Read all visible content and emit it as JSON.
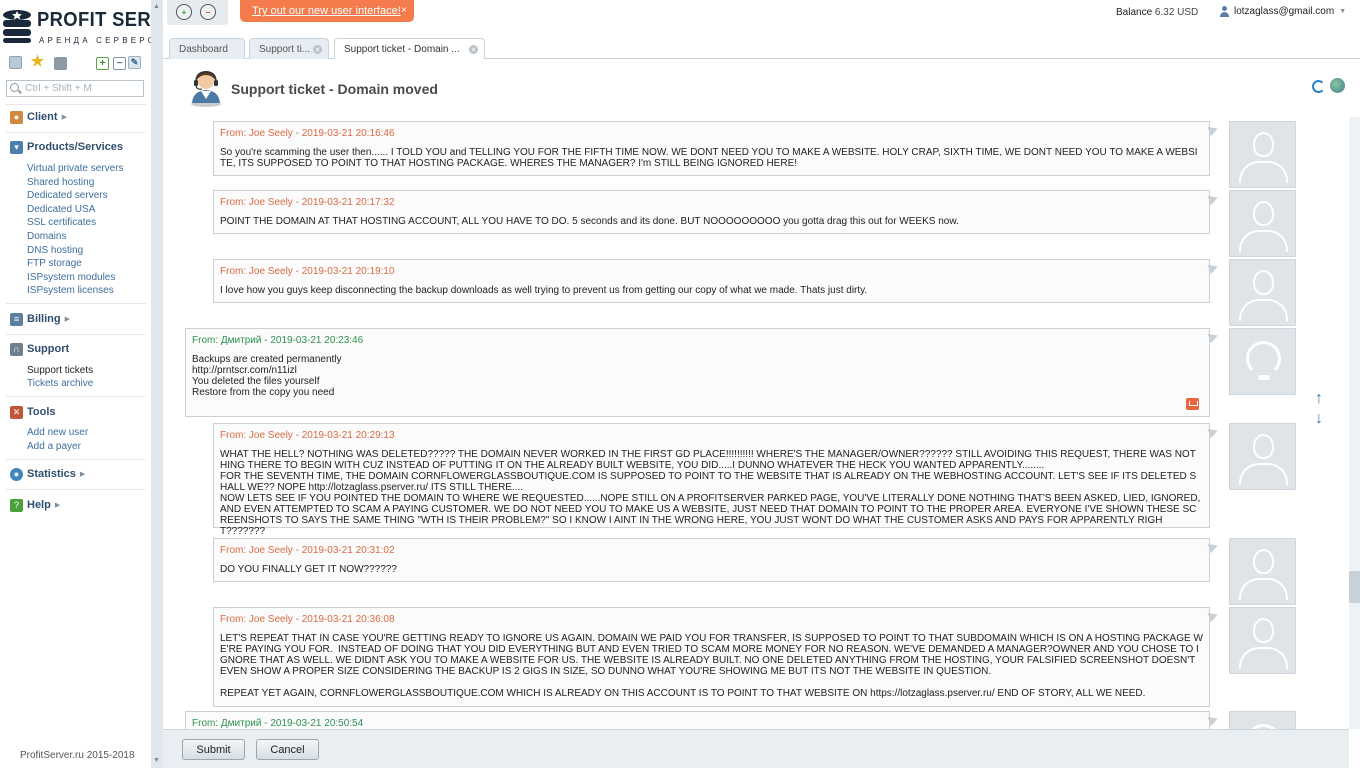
{
  "app": {
    "logo_name": "PROFIT SERVER",
    "logo_sub": "АРЕНДА СЕРВЕРОВ",
    "footer": "ProfitServer.ru 2015-2018"
  },
  "topbar": {
    "promo_text": "Try out our new user interface!",
    "promo_close": "×",
    "balance_label": "Balance",
    "balance_value": "6.32 USD",
    "user_email": "lotzaglass@gmail.com"
  },
  "search": {
    "placeholder": "Ctrl + Shift + M"
  },
  "sidebar": {
    "client": "Client",
    "products": "Products/Services",
    "product_items": [
      "Virtual private servers",
      "Shared hosting",
      "Dedicated servers",
      "Dedicated USA",
      "SSL certificates",
      "Domains",
      "DNS hosting",
      "FTP storage",
      "ISPsystem modules",
      "ISPsystem licenses"
    ],
    "billing": "Billing",
    "support": "Support",
    "support_items": [
      "Support tickets",
      "Tickets archive"
    ],
    "tools": "Tools",
    "tools_items": [
      "Add new user",
      "Add a payer"
    ],
    "statistics": "Statistics",
    "help": "Help"
  },
  "tabs": [
    {
      "label": "Dashboard"
    },
    {
      "label": "Support ti..."
    },
    {
      "label": "Support ticket - Domain ..."
    }
  ],
  "page": {
    "title": "Support ticket - Domain moved"
  },
  "messages": [
    {
      "from": "From: Joe Seely - 2019-03-21 20:16:46",
      "role": "client",
      "body": "So you're scamming the user then...... I TOLD YOU and TELLING YOU FOR THE FIFTH TIME NOW. WE DONT NEED YOU TO MAKE A WEBSITE. HOLY CRAP, SIXTH TIME, WE DONT NEED YOU TO MAKE A WEBSITE, ITS SUPPOSED TO POINT TO THAT HOSTING PACKAGE. WHERES THE MANAGER? I'm STILL BEING IGNORED HERE!"
    },
    {
      "from": "From: Joe Seely - 2019-03-21 20:17:32",
      "role": "client",
      "body": "POINT THE DOMAIN AT THAT HOSTING ACCOUNT, ALL YOU HAVE TO DO. 5 seconds and its done. BUT NOOOOOOOOO you gotta drag this out for WEEKS now."
    },
    {
      "from": "From: Joe Seely - 2019-03-21 20:19:10",
      "role": "client",
      "body": "I love how you guys keep disconnecting the backup downloads as well trying to prevent us from getting our copy of what we made. Thats just dirty."
    },
    {
      "from": "From: Дмитрий - 2019-03-21 20:23:46",
      "role": "staff",
      "body": "Backups are created permanently\nhttp://prntscr.com/n11izl\nYou deleted the files yourself\nRestore from the copy you need"
    },
    {
      "from": "From: Joe Seely - 2019-03-21 20:29:13",
      "role": "client",
      "body": "WHAT THE HELL? NOTHING WAS DELETED????? THE DOMAIN NEVER WORKED IN THE FIRST GD PLACE!!!!!!!!!! WHERE'S THE MANAGER/OWNER?????? STILL AVOIDING THIS REQUEST, THERE WAS NOTHING THERE TO BEGIN WITH CUZ INSTEAD OF PUTTING IT ON THE ALREADY BUILT WEBSITE, YOU DID.....I DUNNO WHATEVER THE HECK YOU WANTED APPARENTLY........\nFOR THE SEVENTH TIME, THE DOMAIN CORNFLOWERGLASSBOUTIQUE.COM IS SUPPOSED TO POINT TO THE WEBSITE THAT IS ALREADY ON THE WEBHOSTING ACCOUNT. LET'S SEE IF ITS DELETED SHALL WE?? NOPE http://lotzaglass.pserver.ru/ ITS STILL THERE....\nNOW LETS SEE IF YOU POINTED THE DOMAIN TO WHERE WE REQUESTED......NOPE STILL ON A PROFITSERVER PARKED PAGE, YOU'VE LITERALLY DONE NOTHING THAT'S BEEN ASKED, LIED, IGNORED, AND EVEN ATTEMPTED TO SCAM A PAYING CUSTOMER. WE DO NOT NEED YOU TO MAKE US A WEBSITE, JUST NEED THAT DOMAIN TO POINT TO THE PROPER AREA. EVERYONE I'VE SHOWN THESE SCREENSHOTS TO SAYS THE SAME THING \"WTH IS THEIR PROBLEM?\" SO I KNOW I AINT IN THE WRONG HERE, YOU JUST WONT DO WHAT THE CUSTOMER ASKS AND PAYS FOR APPARENTLY RIGHT???????"
    },
    {
      "from": "From: Joe Seely - 2019-03-21 20:31:02",
      "role": "client",
      "body": "DO YOU FINALLY GET IT NOW??????"
    },
    {
      "from": "From: Joe Seely - 2019-03-21 20:36:08",
      "role": "client",
      "body": "LET'S REPEAT THAT IN CASE YOU'RE GETTING READY TO IGNORE US AGAIN. DOMAIN WE PAID YOU FOR TRANSFER, IS SUPPOSED TO POINT TO THAT SUBDOMAIN WHICH IS ON A HOSTING PACKAGE WE'RE PAYING YOU FOR.  INSTEAD OF DOING THAT YOU DID EVERYTHING BUT AND EVEN TRIED TO SCAM MORE MONEY FOR NO REASON. WE'VE DEMANDED A MANAGER?OWNER AND YOU CHOSE TO IGNORE THAT AS WELL. WE DIDNT ASK YOU TO MAKE A WEBSITE FOR US. THE WEBSITE IS ALREADY BUILT. NO ONE DELETED ANYTHING FROM THE HOSTING, YOUR FALSIFIED SCREENSHOT DOESN'T EVEN SHOW A PROPER SIZE CONSIDERING THE BACKUP IS 2 GIGS IN SIZE, SO DUNNO WHAT YOU'RE SHOWING ME BUT ITS NOT THE WEBSITE IN QUESTION.\n\nREPEAT YET AGAIN, CORNFLOWERGLASSBOUTIQUE.COM WHICH IS ALREADY ON THIS ACCOUNT IS TO POINT TO THAT WEBSITE ON https://lotzaglass.pserver.ru/ END OF STORY, ALL WE NEED."
    },
    {
      "from": "From: Дмитрий - 2019-03-21 20:50:54",
      "role": "staff",
      "body": ""
    }
  ],
  "buttons": {
    "submit": "Submit",
    "cancel": "Cancel"
  },
  "colors": {
    "client_from": "#d76b45",
    "staff_from": "#2e9150",
    "promo": "#f47c4c",
    "link": "#3e6e9c"
  }
}
